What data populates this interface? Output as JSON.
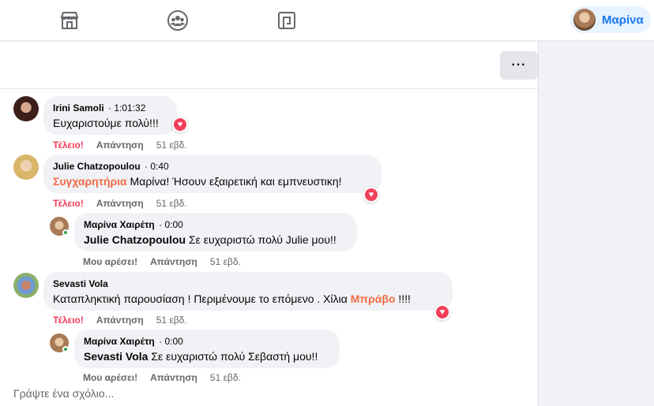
{
  "topbar": {
    "icons": [
      "marketplace-icon",
      "groups-icon",
      "gaming-icon"
    ],
    "profile_name": "Μαρίνα"
  },
  "header": {
    "more_label": "···"
  },
  "comments": [
    {
      "author": "Irini Samoli",
      "time": "· 1:01:32",
      "text": "Ευχαριστούμε πολύ!!!",
      "action1": "Τέλειο!",
      "reply": "Απάντηση",
      "age": "51 εβδ."
    },
    {
      "author": "Julie Chatzopoulou",
      "time": "· 0:40",
      "highlight": "Συγχαρητήρια",
      "text": " Μαρίνα! Ήσουν εξαιρετική και εμπνευστικη!",
      "action1": "Τέλειο!",
      "reply": "Απάντηση",
      "age": "51 εβδ."
    },
    {
      "author": "Μαρίνα Χαιρέτη",
      "time": "· 0:00",
      "mention": "Julie Chatzopoulou",
      "text": " Σε ευχαριστώ πολύ Julie μου!!",
      "action1": "Μου αρέσει!",
      "reply": "Απάντηση",
      "age": "51 εβδ."
    },
    {
      "author": "Sevasti Vola",
      "text_before": "Καταπληκτική παρουσίαση ! Περιμένουμε το επόμενο . Χίλια ",
      "highlight": "Μπράβο",
      "text_after": " !!!!",
      "action1": "Τέλειο!",
      "reply": "Απάντηση",
      "age": "51 εβδ."
    },
    {
      "author": "Μαρίνα Χαιρέτη",
      "time": "· 0:00",
      "mention": "Sevasti Vola",
      "text": " Σε ευχαριστώ πολύ Σεβαστή μου!!",
      "action1": "Μου αρέσει!",
      "reply": "Απάντηση",
      "age": "51 εβδ."
    }
  ],
  "composer": {
    "placeholder": "Γράψτε ένα σχόλιο..."
  },
  "colors": {
    "accent": "#1877f2",
    "love": "#f33e58",
    "highlight": "#f36b45"
  }
}
